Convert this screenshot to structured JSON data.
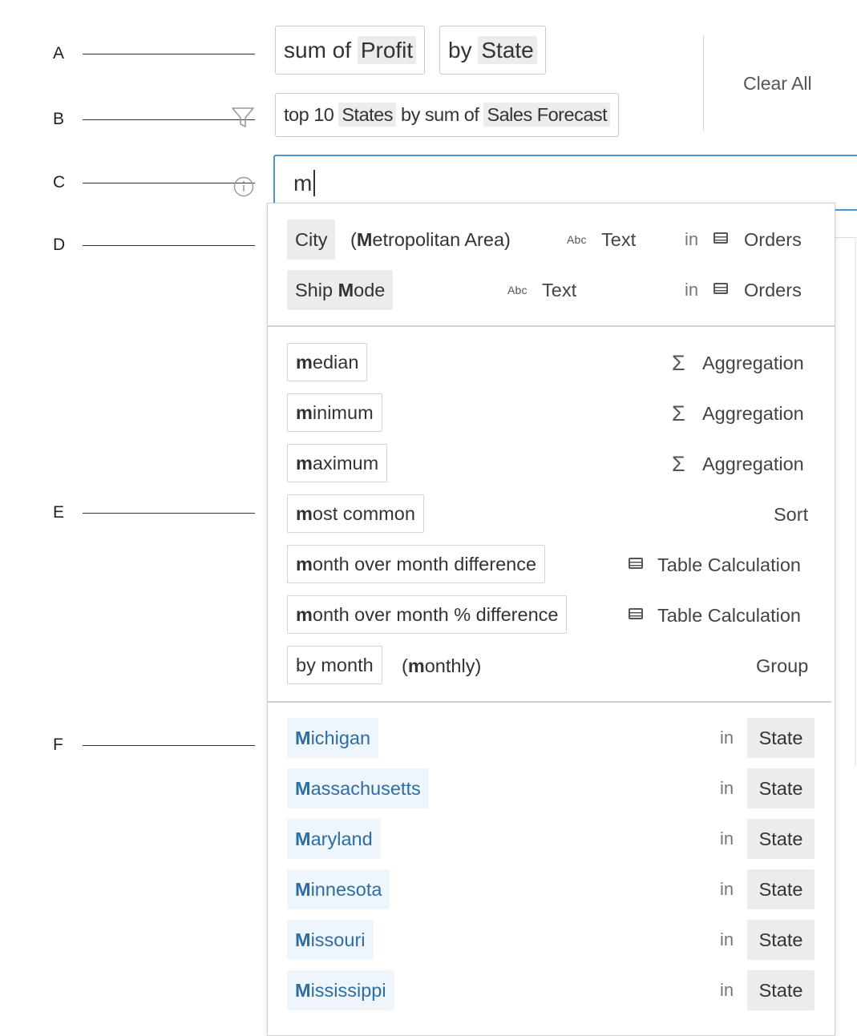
{
  "callouts": [
    "A",
    "B",
    "C",
    "D",
    "E",
    "F"
  ],
  "header": {
    "pill_sum_prefix": "sum of ",
    "pill_sum_field": "Profit",
    "pill_by_prefix": "by ",
    "pill_by_field": "State",
    "filter_prefix": "top 10 ",
    "filter_field1": "States",
    "filter_middle": " by sum of ",
    "filter_field2": "Sales Forecast",
    "clear_all": "Clear All"
  },
  "search": {
    "value": "m"
  },
  "fields": [
    {
      "label": "City",
      "alias_open": "(",
      "alias_bold": "M",
      "alias_rest": "etropolitan Area)",
      "type_icon": "Abc",
      "type": "Text",
      "in": "in",
      "source": "Orders"
    },
    {
      "label_prefix": "Ship ",
      "label_bold": "M",
      "label_rest": "ode",
      "type_icon": "Abc",
      "type": "Text",
      "in": "in",
      "source": "Orders"
    }
  ],
  "keywords": [
    {
      "bold": "m",
      "rest": "edian",
      "category": "Aggregation",
      "icon": "sigma-icon"
    },
    {
      "bold": "m",
      "rest": "inimum",
      "category": "Aggregation",
      "icon": "sigma-icon"
    },
    {
      "bold": "m",
      "rest": "aximum",
      "category": "Aggregation",
      "icon": "sigma-icon"
    },
    {
      "bold": "m",
      "rest": "ost common",
      "category": "Sort",
      "icon": ""
    },
    {
      "bold": "m",
      "rest": "onth over month difference",
      "category": "Table Calculation",
      "icon": "table-icon"
    },
    {
      "bold": "m",
      "rest": "onth over month % difference",
      "category": "Table Calculation",
      "icon": "table-icon"
    },
    {
      "bold": "",
      "rest": "by month",
      "alias_open": "(",
      "alias_bold": "m",
      "alias_rest": "onthly)",
      "category": "Group",
      "icon": ""
    }
  ],
  "values": [
    {
      "bold": "M",
      "rest": "ichigan",
      "in": "in",
      "field": "State"
    },
    {
      "bold": "M",
      "rest": "assachusetts",
      "in": "in",
      "field": "State"
    },
    {
      "bold": "M",
      "rest": "aryland",
      "in": "in",
      "field": "State"
    },
    {
      "bold": "M",
      "rest": "innesota",
      "in": "in",
      "field": "State"
    },
    {
      "bold": "M",
      "rest": "issouri",
      "in": "in",
      "field": "State"
    },
    {
      "bold": "M",
      "rest": "ississippi",
      "in": "in",
      "field": "State"
    }
  ],
  "colors": {
    "accent": "#4e95d4",
    "value_text": "#2e6da4",
    "chip_bg": "#ececec"
  }
}
